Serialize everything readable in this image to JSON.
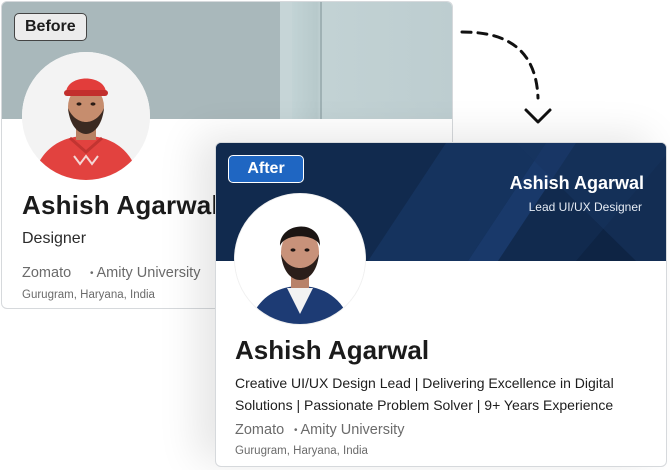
{
  "before": {
    "badge": "Before",
    "name": "Ashish Agarwal",
    "title": "Designer",
    "company": "Zomato",
    "school": "Amity University",
    "location": "Gurugram, Haryana, India"
  },
  "after": {
    "badge": "After",
    "banner_name": "Ashish Agarwal",
    "banner_title": "Lead UI/UX Designer",
    "name": "Ashish Agarwal",
    "headline": "Creative UI/UX Design Lead | Delivering Excellence in Digital Solutions | Passionate Problem Solver | 9+ Years Experience",
    "company": "Zomato",
    "school": "Amity University",
    "location": "Gurugram, Haryana, India"
  },
  "icons": {
    "arrow": "dashed-curved-arrow-icon",
    "separator": "bullet-dot-icon"
  },
  "colors": {
    "after_banner": "#112a4e",
    "after_badge": "#1f66c2",
    "before_banner": "#a9babd",
    "before_shirt": "#e2423f"
  }
}
